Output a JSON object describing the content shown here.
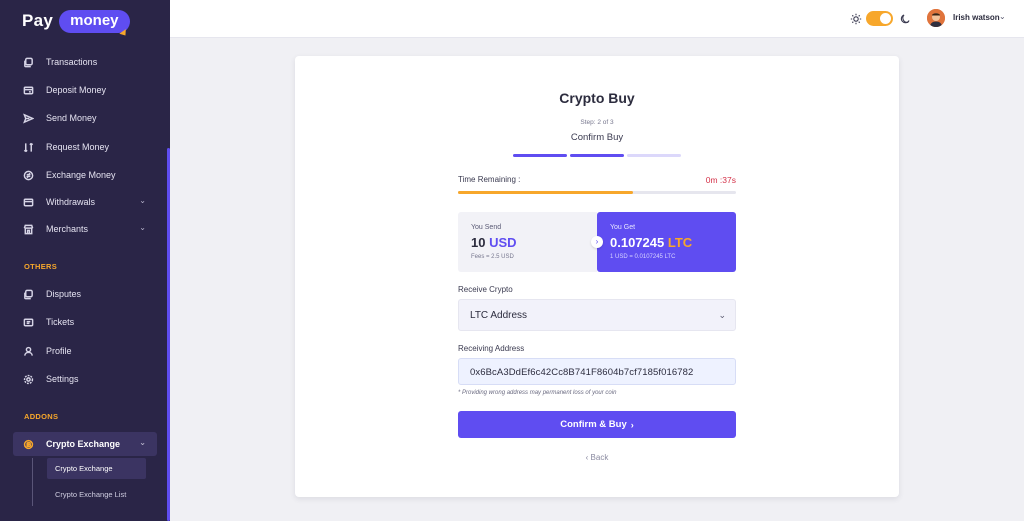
{
  "brand": {
    "part1": "Pay",
    "part2": "money",
    "accent": "#5f4df1",
    "highlight": "#f7a72b"
  },
  "sidebar": {
    "items": [
      {
        "label": "Transactions",
        "icon": "transactions-icon"
      },
      {
        "label": "Deposit Money",
        "icon": "deposit-icon"
      },
      {
        "label": "Send Money",
        "icon": "send-icon"
      },
      {
        "label": "Request Money",
        "icon": "request-icon"
      },
      {
        "label": "Exchange Money",
        "icon": "exchange-icon"
      },
      {
        "label": "Withdrawals",
        "icon": "withdrawals-icon"
      },
      {
        "label": "Merchants",
        "icon": "merchants-icon"
      }
    ],
    "others_label": "OTHERS",
    "others": [
      {
        "label": "Disputes",
        "icon": "disputes-icon"
      },
      {
        "label": "Tickets",
        "icon": "tickets-icon"
      },
      {
        "label": "Profile",
        "icon": "profile-icon"
      },
      {
        "label": "Settings",
        "icon": "settings-icon"
      }
    ],
    "addons_label": "ADDONS",
    "active": {
      "label": "Crypto Exchange",
      "icon": "crypto-exchange-icon"
    },
    "sub_items": [
      "Crypto Exchange",
      "Crypto Exchange List"
    ]
  },
  "header": {
    "username": "Irish watson",
    "theme_toggle": "light"
  },
  "form": {
    "title": "Crypto Buy",
    "step": "Step: 2 of 3",
    "subtitle": "Confirm Buy",
    "steps_completed": 2,
    "steps_total": 3,
    "time_label": "Time Remaining :",
    "time_value": "0m :37s",
    "time_progress": 0.63,
    "send": {
      "label": "You Send",
      "amount": "10",
      "currency": "USD",
      "note": "Fees = 2.5 USD"
    },
    "get": {
      "label": "You Get",
      "amount": "0.107245",
      "currency": "LTC",
      "note": "1 USD = 0.0107245 LTC"
    },
    "receive_label": "Receive Crypto",
    "receive_value": "LTC Address",
    "address_label": "Receiving Address",
    "address_value": "0x6BcA3DdEf6c42Cc8B741F8604b7cf7185f016782",
    "warning": "* Providing wrong address may permanent loss of your coin",
    "confirm_label": "Confirm & Buy",
    "back_label": "Back"
  }
}
